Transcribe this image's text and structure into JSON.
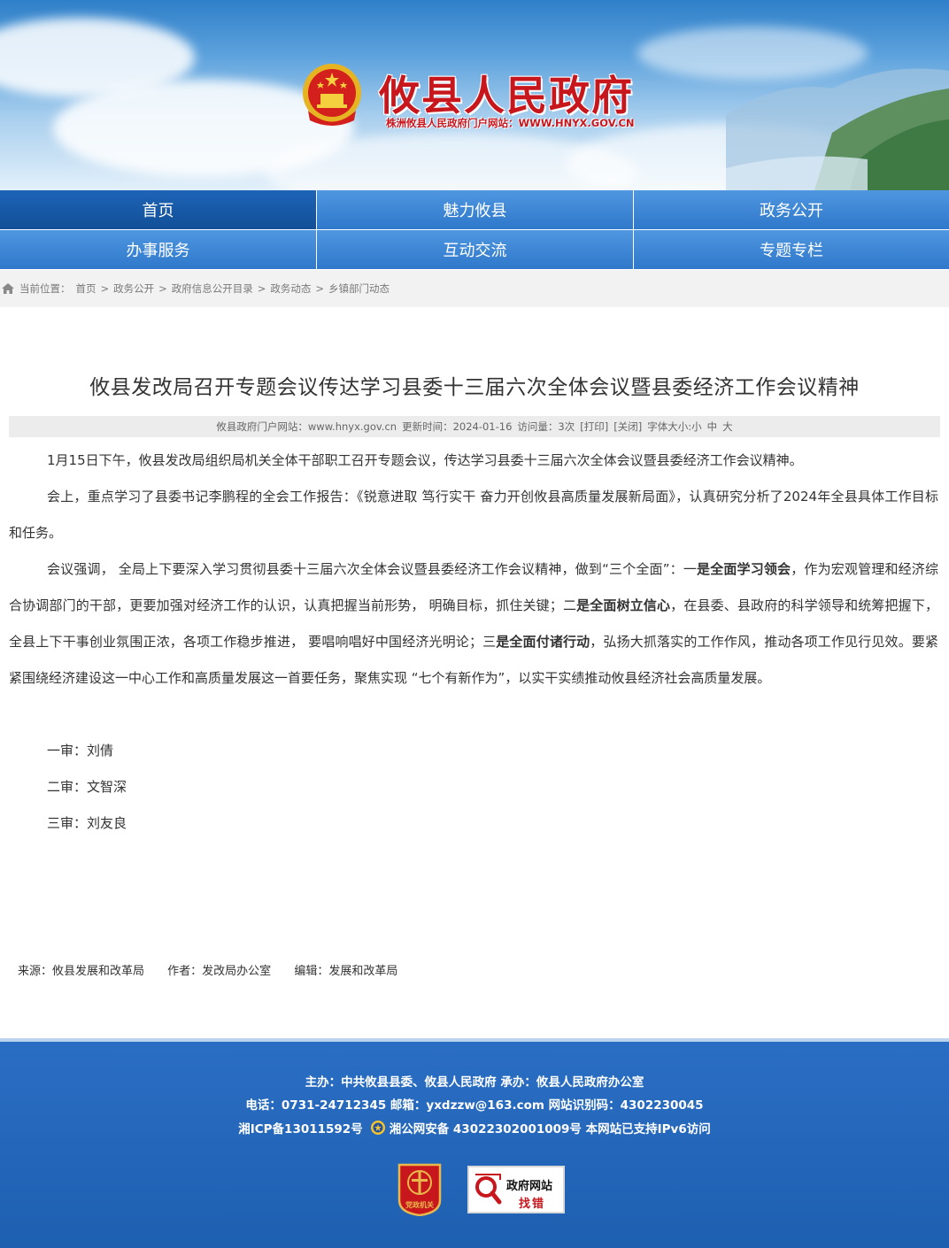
{
  "banner": {
    "site_title": "攸县人民政府",
    "site_subtitle": "株洲攸县人民政府门户网站：WWW.HNYX.GOV.CN"
  },
  "nav": {
    "items": [
      {
        "label": "首页",
        "active": true
      },
      {
        "label": "魅力攸县",
        "active": false
      },
      {
        "label": "政务公开",
        "active": false
      },
      {
        "label": "办事服务",
        "active": false
      },
      {
        "label": "互动交流",
        "active": false
      },
      {
        "label": "专题专栏",
        "active": false
      }
    ]
  },
  "breadcrumb": {
    "label": "当前位置：",
    "items": [
      "首页",
      "政务公开",
      "政府信息公开目录",
      "政务动态",
      "乡镇部门动态"
    ],
    "separator": ">"
  },
  "article": {
    "title": "攸县发改局召开专题会议传达学习县委十三届六次全体会议暨县委经济工作会议精神",
    "meta": {
      "site": "攸县政府门户网站：www.hnyx.gov.cn",
      "updated": "更新时间：2024-01-16",
      "visits": "访问量：3次",
      "print": "[打印]",
      "close": "[关闭]",
      "font_size_label": "字体大小:",
      "font_small": "小",
      "font_medium": "中",
      "font_large": "大"
    },
    "paragraph1": "1月15日下午，攸县发改局组织局机关全体干部职工召开专题会议，传达学习县委十三届六次全体会议暨县委经济工作会议精神。",
    "paragraph2": "会上，重点学习了县委书记李鹏程的全会工作报告：《锐意进取 笃行实干 奋力开创攸县高质量发展新局面》，认真研究分析了2024年全县具体工作目标和任务。",
    "p3": {
      "part1": "会议强调， 全局上下要深入学习贯彻县委十三届六次全体会议暨县委经济工作会议精神，做到“三个全面”：一",
      "bold1": "是全面学习领会",
      "part2": "，作为宏观管理和经济综合协调部门的干部，更要加强对经济工作的认识，认真把握当前形势， 明确目标，抓住关键；二",
      "bold2": "是全面树立信心",
      "part3": "，在县委、县政府的科学领导和统筹把握下，全县上下干事创业氛围正浓，各项工作稳步推进， 要唱响唱好中国经济光明论；三",
      "bold3": "是全面付诸行动",
      "part4": "，弘扬大抓落实的工作作风，推动各项工作见行见效。要紧紧围绕经济建设这一中心工作和高质量发展这一首要任务，聚焦实现 “七个有新作为”，以实干实绩推动攸县经济社会高质量发展。"
    },
    "review1": "一审：刘倩",
    "review2": "二审：文智深",
    "review3": "三审：刘友良",
    "source": "来源：攸县发展和改革局",
    "author": "作者：发改局办公室",
    "editor": "编辑：发展和改革局"
  },
  "footer": {
    "line1": "主办：中共攸县县委、攸县人民政府 承办：攸县人民政府办公室",
    "line2": "电话：0731-24712345  邮箱：yxdzzw@163.com  网站识别码：4302230045",
    "icp": "湘ICP备13011592号",
    "police": "湘公网安备 43022302001009号  本网站已支持IPv6访问",
    "badge_party_text": "党政机关",
    "badge_error_title": "政府网站",
    "badge_error_sub": "找错"
  },
  "colors": {
    "brand_red": "#c8161d",
    "nav_blue": "#2f78cb",
    "nav_active": "#124f98",
    "footer_blue": "#1e5fb0"
  }
}
